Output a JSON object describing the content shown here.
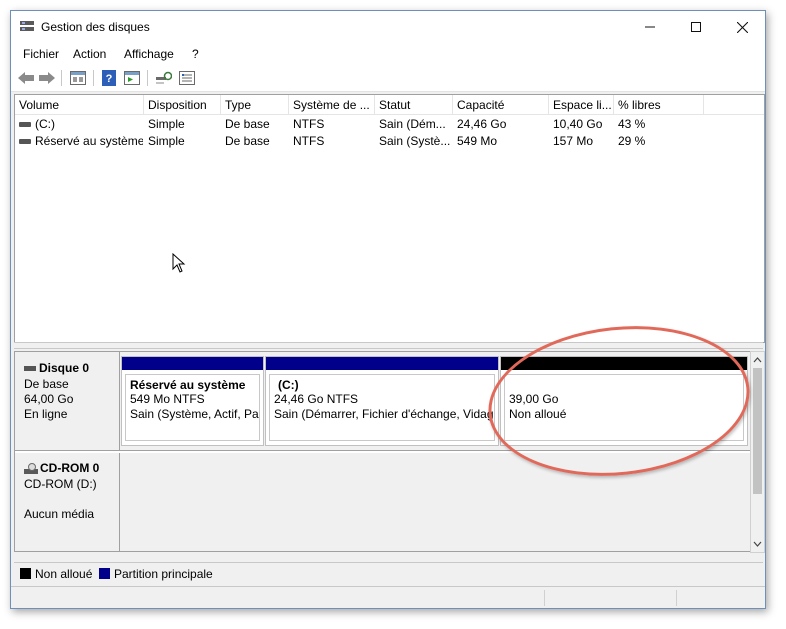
{
  "window": {
    "title": "Gestion des disques",
    "minimize": "—",
    "maximize": "☐",
    "close": "✕"
  },
  "menu": [
    "Fichier",
    "Action",
    "Affichage",
    "?"
  ],
  "toolbar": {
    "icons": [
      "back-icon",
      "forward-icon",
      "properties-icon",
      "help-icon",
      "detail-icon",
      "rescan-icon",
      "list-view-icon"
    ]
  },
  "volume_list": {
    "columns": [
      "Volume",
      "Disposition",
      "Type",
      "Système de ...",
      "Statut",
      "Capacité",
      "Espace li...",
      "% libres"
    ],
    "rows": [
      {
        "volume": "(C:)",
        "layout": "Simple",
        "type": "De base",
        "fs": "NTFS",
        "status": "Sain (Dém...",
        "capacity": "24,46 Go",
        "free": "10,40 Go",
        "pct": "43 %"
      },
      {
        "volume": "Réservé au système",
        "layout": "Simple",
        "type": "De base",
        "fs": "NTFS",
        "status": "Sain (Systè...",
        "capacity": "549 Mo",
        "free": "157 Mo",
        "pct": "29 %"
      }
    ]
  },
  "disks": [
    {
      "name": "Disque 0",
      "lines": [
        "De base",
        "64,00 Go",
        "En ligne"
      ],
      "partitions": [
        {
          "title": "Réservé au système",
          "line1": "549 Mo NTFS",
          "line2": "Sain (Système, Actif, Partition principale)",
          "color": "#00008b"
        },
        {
          "title": "(C:)",
          "line1": "24,46 Go NTFS",
          "line2": "Sain (Démarrer, Fichier d'échange, Vidage sur incident, Partition principale)",
          "color": "#00008b"
        },
        {
          "title": "",
          "line1": "39,00 Go",
          "line2": "Non alloué",
          "color": "#000000"
        }
      ]
    },
    {
      "name": "CD-ROM 0",
      "lines": [
        "CD-ROM (D:)",
        "",
        "Aucun média"
      ]
    }
  ],
  "legend": [
    {
      "label": "Non alloué",
      "color": "#000000"
    },
    {
      "label": "Partition principale",
      "color": "#00008b"
    }
  ],
  "annotation": {
    "color": "#e1695a"
  }
}
